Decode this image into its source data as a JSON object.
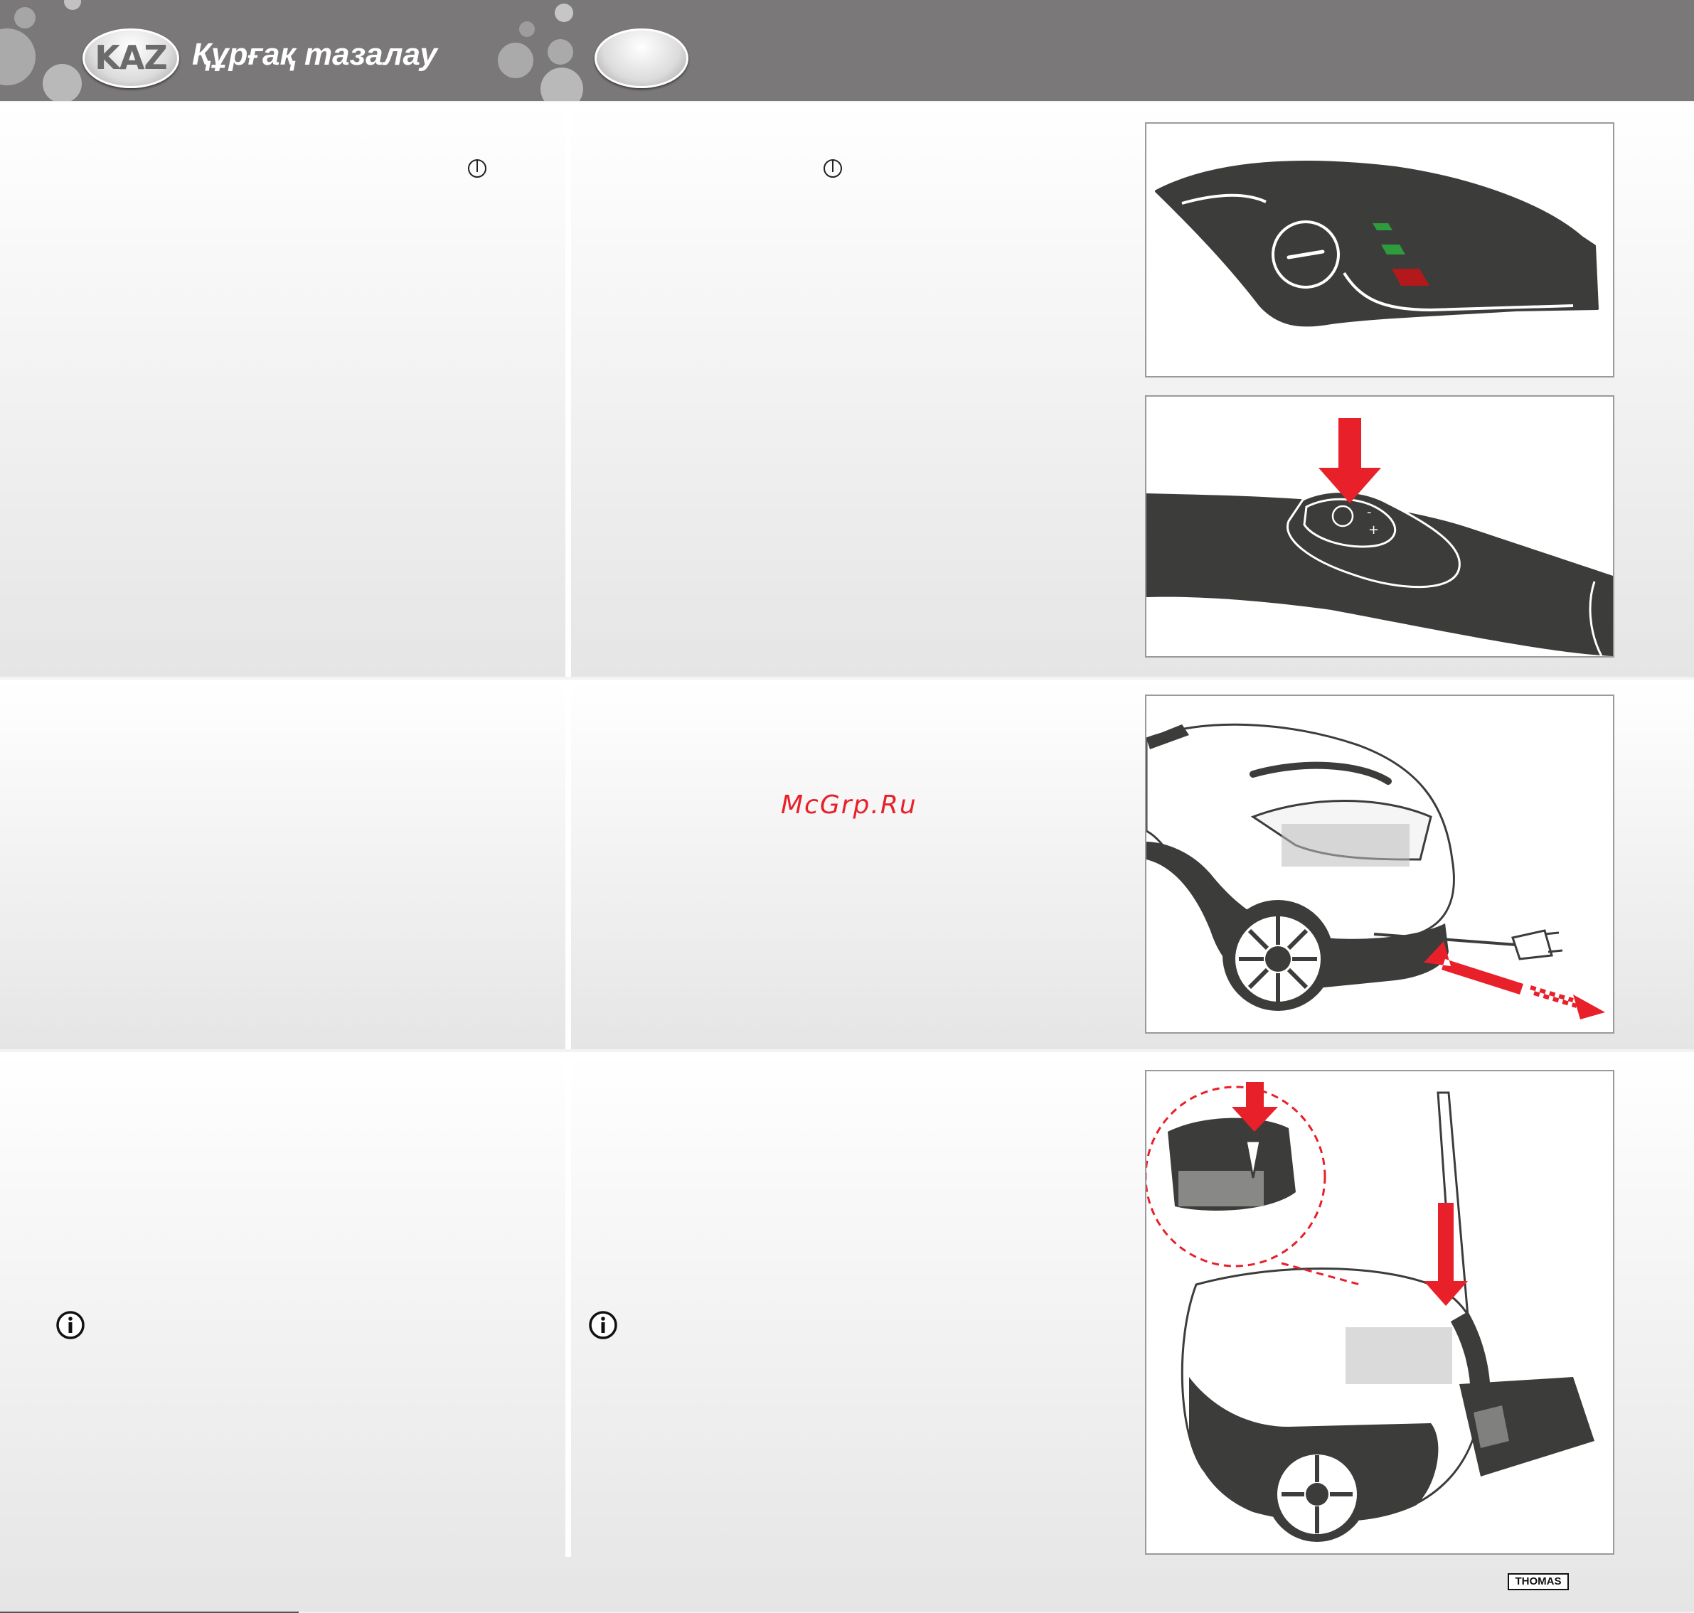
{
  "header": {
    "language_code": "KAZ",
    "title": "Құрғақ тазалау",
    "second_language_code": ""
  },
  "watermark": {
    "text": "McGrp.Ru"
  },
  "footer": {
    "brand": "THOMAS"
  },
  "colors": {
    "header_bg": "#7a7878",
    "indicator_green": "#2e9c3d",
    "indicator_red": "#b3191b",
    "arrow_red": "#e8202a",
    "device_dark": "#3c3c3b"
  },
  "icons": [
    "power-icon",
    "info-icon"
  ]
}
